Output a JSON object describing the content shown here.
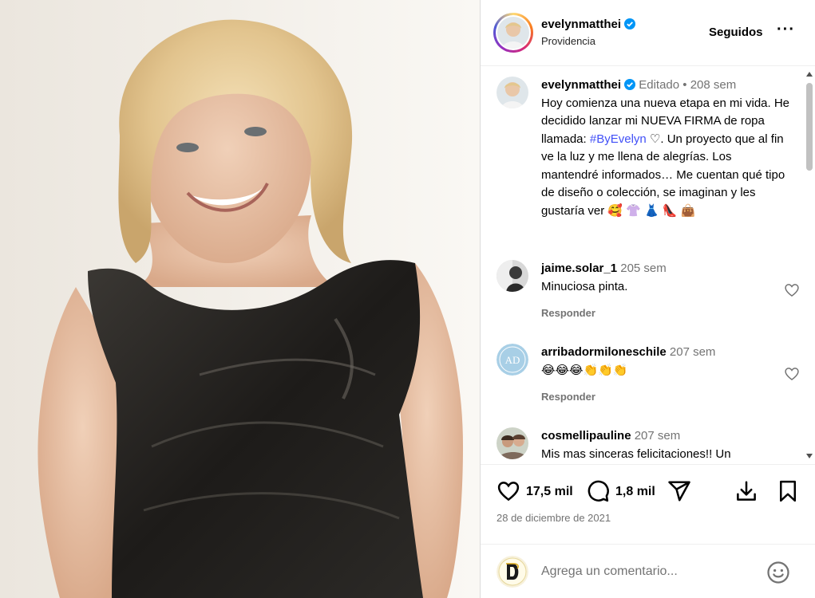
{
  "post": {
    "photo_alt": "photo-of-woman-in-black-dress"
  },
  "header": {
    "username": "evelynmatthei",
    "location": "Providencia",
    "follow_label": "Seguidos",
    "more_label": "···"
  },
  "caption": {
    "username": "evelynmatthei",
    "edited": "Editado",
    "dot": " • ",
    "time": "208 sem",
    "text_before_tag": "Hoy comienza una nueva etapa en mi vida. He decidido lanzar mi NUEVA FIRMA de ropa llamada: ",
    "hashtag": "#ByEvelyn",
    "text_after_tag": " ♡. Un proyecto que al fin ve la luz y me llena de alegrías. Los mantendré informados… Me cuentan qué tipo de diseño o colección, se imaginan y les gustaría ver ",
    "emojis": "🥰 👚 👗 👠 👜"
  },
  "comments": [
    {
      "username": "jaime.solar_1",
      "time": "205 sem",
      "text": "Minuciosa pinta.",
      "reply_label": "Responder"
    },
    {
      "username": "arribadormiloneschile",
      "time": "207 sem",
      "text": "😂😂😂👏👏👏",
      "reply_label": "Responder",
      "avatar_text": "AD"
    },
    {
      "username": "cosmellipauline",
      "time": "207 sem",
      "text": "Mis mas sinceras felicitaciones!! Un"
    }
  ],
  "actions": {
    "likes": "17,5 mil",
    "comments": "1,8 mil",
    "date": "28 de diciembre de 2021"
  },
  "add_comment": {
    "placeholder": "Agrega un comentario..."
  },
  "colors": {
    "accent_link": "#4150f7",
    "secondary_text": "#737373",
    "verified_blue": "#0095f6"
  }
}
